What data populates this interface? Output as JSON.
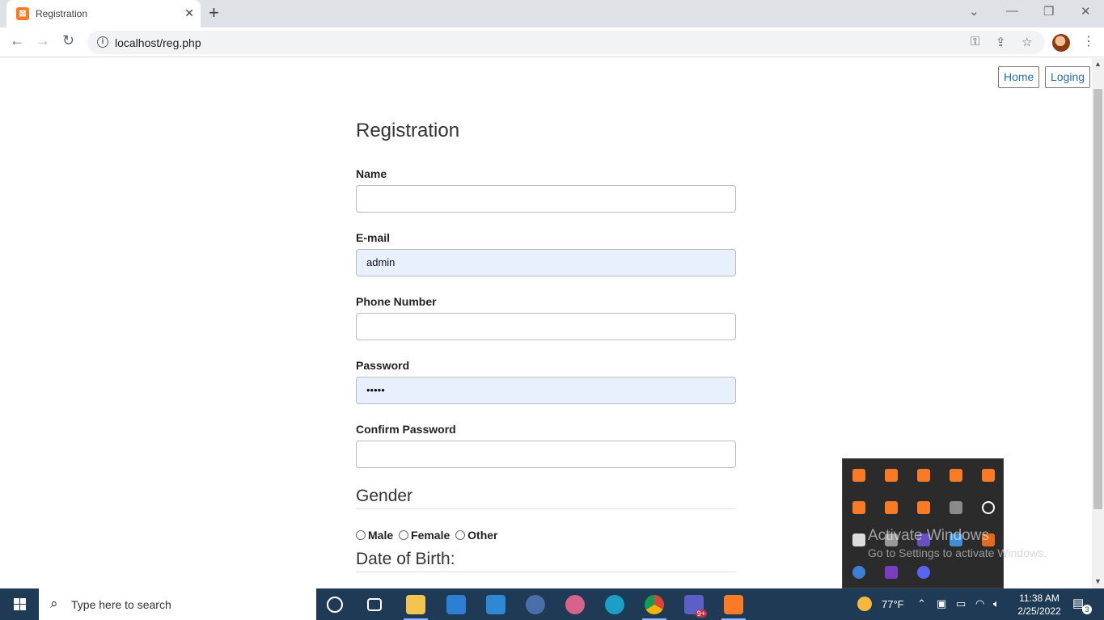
{
  "browser": {
    "tab_title": "Registration",
    "tab_favicon": "xampp-icon",
    "url": "localhost/reg.php"
  },
  "nav": {
    "home_label": "Home",
    "login_label": "Loging"
  },
  "form": {
    "title": "Registration",
    "name_label": "Name",
    "name_value": "",
    "email_label": "E-mail",
    "email_value": "admin",
    "phone_label": "Phone Number",
    "phone_value": "",
    "password_label": "Password",
    "password_value": "•••••",
    "confirm_label": "Confirm Password",
    "confirm_value": "",
    "gender_heading": "Gender",
    "gender_options": [
      "Male",
      "Female",
      "Other"
    ],
    "dob_heading": "Date of Birth:"
  },
  "windows": {
    "watermark_title": "Activate Windows",
    "watermark_sub": "Go to Settings to activate Windows."
  },
  "taskbar": {
    "search_placeholder": "Type here to search",
    "weather": "77°F",
    "time": "11:38 AM",
    "date": "2/25/2022",
    "notifications": "3",
    "teams_badge": "9+"
  },
  "colors": {
    "accent_link": "#2a6db0",
    "autofill_bg": "#e8f0fe",
    "taskbar": "#1f3a55",
    "xampp_orange": "#fb7a24"
  }
}
